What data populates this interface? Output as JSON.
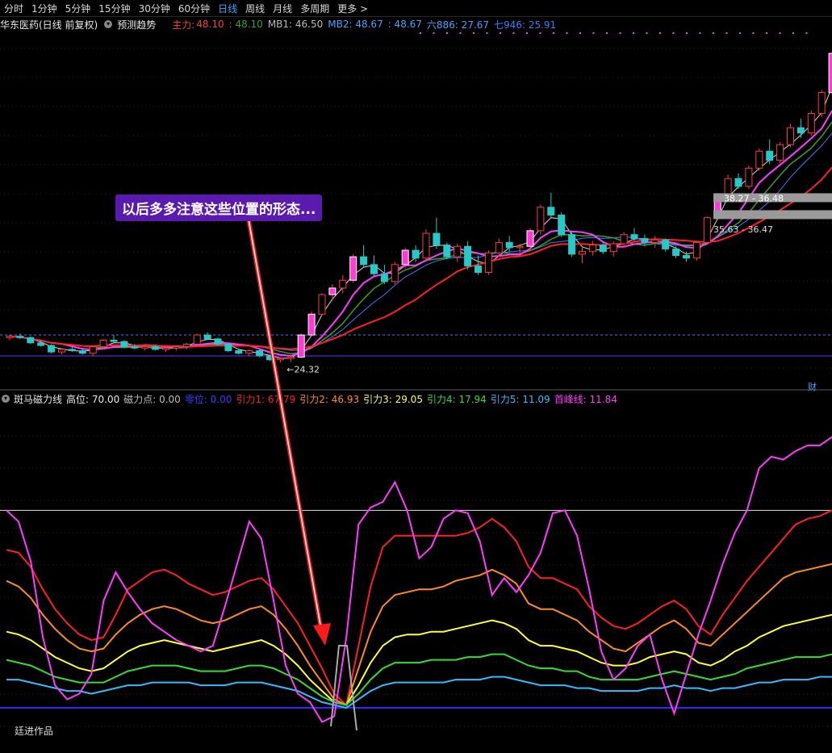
{
  "toolbar": {
    "timeframes": [
      "分时",
      "1分钟",
      "5分钟",
      "15分钟",
      "30分钟",
      "60分钟",
      "日线",
      "周线",
      "月线",
      "多周期",
      "更多 >"
    ],
    "active": "日线"
  },
  "header": {
    "stock": "华东医药(日线 前复权)",
    "forecast_btn": "预测趋势",
    "zhuli_label": "主力:",
    "zhuli_value": "48.10",
    "v2": ": 48.10",
    "mb1": "MB1: 46.50",
    "mb2": "MB2: 48.67",
    "v3": ": 48.67",
    "liu": "六886: 27.67",
    "qi": "七946: 25.91"
  },
  "callout": "以后多多注意这些位置的形态...",
  "indicator_header": {
    "name": "斑马磁力线",
    "gaowei": "高位: 70.00",
    "cilidian": "磁力点: 0.00",
    "lingwei": "零位: 0.00",
    "y1": "引力1: 67.79",
    "y2": "引力2: 46.93",
    "y3": "引力3: 29.05",
    "y4": "引力4: 17.94",
    "y5": "引力5: 11.09",
    "sf": "首峰线: 11.84"
  },
  "author": "廷进作品",
  "cai": "财",
  "colors": {
    "up": "#ff3b3b",
    "down": "#27c8c8",
    "signal_fill": "#ff3bd2",
    "ma_white": "#d8d8d8",
    "ma_mag": "#ff3bff",
    "ma_red": "#ff2020",
    "ma_green": "#2ea52e",
    "ma_blue": "#3b7bff",
    "y1": "#ff2020",
    "y2": "#ff8c1a",
    "y3": "#ffff33",
    "y4": "#33dd33",
    "y5": "#33bbff",
    "sf": "#ff3bff",
    "zhuli": "#ff3b3b",
    "mb2": "#3ea6ff",
    "liu": "#3ea6ff",
    "qi": "#3b7bff"
  },
  "chart_data": [
    {
      "type": "candlestick",
      "title": "华东医药(日线 前复权)",
      "candles": [
        [
          26.2,
          26.4,
          26.0,
          26.3
        ],
        [
          26.3,
          26.5,
          26.1,
          26.2
        ],
        [
          26.2,
          26.3,
          25.7,
          25.8
        ],
        [
          25.8,
          26.0,
          25.5,
          25.6
        ],
        [
          25.6,
          25.7,
          25.0,
          25.1
        ],
        [
          25.1,
          25.4,
          24.9,
          25.3
        ],
        [
          25.3,
          25.5,
          25.1,
          25.2
        ],
        [
          25.2,
          25.4,
          24.9,
          25.0
        ],
        [
          25.0,
          25.6,
          24.8,
          25.5
        ],
        [
          25.5,
          26.1,
          25.3,
          26.0
        ],
        [
          26.0,
          26.4,
          25.8,
          25.9
        ],
        [
          25.9,
          26.0,
          25.4,
          25.5
        ],
        [
          25.5,
          25.7,
          25.3,
          25.4
        ],
        [
          25.4,
          25.6,
          25.2,
          25.5
        ],
        [
          25.5,
          25.6,
          25.2,
          25.3
        ],
        [
          25.3,
          25.5,
          25.1,
          25.4
        ],
        [
          25.4,
          25.6,
          25.2,
          25.5
        ],
        [
          25.5,
          25.8,
          25.3,
          25.7
        ],
        [
          25.7,
          26.5,
          25.6,
          26.4
        ],
        [
          26.4,
          26.6,
          26.0,
          26.1
        ],
        [
          26.1,
          26.2,
          25.6,
          25.7
        ],
        [
          25.7,
          25.8,
          25.1,
          25.2
        ],
        [
          25.2,
          25.3,
          24.9,
          25.0
        ],
        [
          25.0,
          25.3,
          24.8,
          25.2
        ],
        [
          25.2,
          25.3,
          24.7,
          24.8
        ],
        [
          24.8,
          24.9,
          24.4,
          24.5
        ],
        [
          24.5,
          24.7,
          24.3,
          24.6
        ],
        [
          24.6,
          24.8,
          24.32,
          24.7
        ],
        [
          24.7,
          26.5,
          24.6,
          26.4
        ],
        [
          26.4,
          28.2,
          26.3,
          28.0
        ],
        [
          28.0,
          29.6,
          27.9,
          29.5
        ],
        [
          29.5,
          30.3,
          29.0,
          30.0
        ],
        [
          30.0,
          31.0,
          29.6,
          30.6
        ],
        [
          30.6,
          32.6,
          30.4,
          32.4
        ],
        [
          32.4,
          33.3,
          31.6,
          31.8
        ],
        [
          31.8,
          32.5,
          30.9,
          31.1
        ],
        [
          31.1,
          31.8,
          30.3,
          30.5
        ],
        [
          30.5,
          32.0,
          30.3,
          31.8
        ],
        [
          31.8,
          33.1,
          31.5,
          32.9
        ],
        [
          32.9,
          33.3,
          32.0,
          32.3
        ],
        [
          32.3,
          34.5,
          32.0,
          34.2
        ],
        [
          34.2,
          35.4,
          33.0,
          33.3
        ],
        [
          33.3,
          33.5,
          32.2,
          32.4
        ],
        [
          32.4,
          33.4,
          32.0,
          33.2
        ],
        [
          33.2,
          33.6,
          31.4,
          31.7
        ],
        [
          31.7,
          32.5,
          31.0,
          31.2
        ],
        [
          31.2,
          32.9,
          31.0,
          32.7
        ],
        [
          32.7,
          33.8,
          32.4,
          33.5
        ],
        [
          33.5,
          34.0,
          32.8,
          33.1
        ],
        [
          33.1,
          33.4,
          32.6,
          33.2
        ],
        [
          33.2,
          34.6,
          33.0,
          34.4
        ],
        [
          34.4,
          36.4,
          34.1,
          36.2
        ],
        [
          36.2,
          37.3,
          35.4,
          35.6
        ],
        [
          35.6,
          35.8,
          33.9,
          34.1
        ],
        [
          34.1,
          34.4,
          32.4,
          32.6
        ],
        [
          32.6,
          33.1,
          31.9,
          32.8
        ],
        [
          32.8,
          33.6,
          32.5,
          33.3
        ],
        [
          33.3,
          33.6,
          32.6,
          32.8
        ],
        [
          32.8,
          33.6,
          32.4,
          33.4
        ],
        [
          33.4,
          34.3,
          33.1,
          34.1
        ],
        [
          34.1,
          34.6,
          33.6,
          33.8
        ],
        [
          33.8,
          34.1,
          33.2,
          33.5
        ],
        [
          33.5,
          34.0,
          33.1,
          33.7
        ],
        [
          33.7,
          33.8,
          32.8,
          33.0
        ],
        [
          33.0,
          33.2,
          32.3,
          32.5
        ],
        [
          32.5,
          32.8,
          32.0,
          32.3
        ],
        [
          32.3,
          33.6,
          32.1,
          33.5
        ],
        [
          33.5,
          35.5,
          33.4,
          35.4
        ],
        [
          35.4,
          37.3,
          35.2,
          37.1
        ],
        [
          37.1,
          38.7,
          36.8,
          38.4
        ],
        [
          38.4,
          38.8,
          37.6,
          37.8
        ],
        [
          37.8,
          39.4,
          37.6,
          39.2
        ],
        [
          39.2,
          40.7,
          39.0,
          40.5
        ],
        [
          40.5,
          41.4,
          39.5,
          39.8
        ],
        [
          39.8,
          41.2,
          39.6,
          41.0
        ],
        [
          41.0,
          42.6,
          40.8,
          42.3
        ],
        [
          42.3,
          43.0,
          41.5,
          41.9
        ],
        [
          41.9,
          43.6,
          41.7,
          43.4
        ],
        [
          43.4,
          45.2,
          43.1,
          45.0
        ],
        [
          45.0,
          48.1,
          44.8,
          48.0
        ]
      ],
      "annotations": [
        "←24.32",
        "38.27 - 36.48",
        "35.63 - 36.47"
      ]
    },
    {
      "type": "line",
      "title": "斑马磁力线",
      "reference_levels": {
        "高位": 70.0,
        "零位": 0.0
      },
      "series": [
        {
          "name": "引力1",
          "color": "#ff2020",
          "values": [
            56,
            55,
            50,
            42,
            35,
            30,
            26,
            24,
            25,
            33,
            42,
            45,
            48,
            49,
            47,
            44,
            42,
            40,
            41,
            43,
            45,
            46,
            42,
            36,
            30,
            22,
            14,
            5,
            1,
            22,
            43,
            57,
            61,
            61,
            61,
            61,
            61,
            61,
            62,
            64,
            67,
            64,
            59,
            50,
            46,
            46,
            44,
            42,
            36,
            32,
            29,
            28,
            30,
            33,
            36,
            38,
            35,
            29,
            26,
            33,
            39,
            45,
            50,
            55,
            60,
            65,
            67,
            68,
            70
          ]
        },
        {
          "name": "引力2",
          "color": "#ff8c1a",
          "values": [
            45,
            43,
            39,
            33,
            28,
            24,
            21,
            20,
            21,
            26,
            30,
            33,
            35,
            36,
            35,
            33,
            31,
            30,
            31,
            33,
            35,
            36,
            33,
            28,
            22,
            15,
            9,
            3,
            1,
            14,
            27,
            36,
            40,
            41,
            42,
            42,
            43,
            45,
            46,
            47,
            49,
            47,
            44,
            37,
            35,
            35,
            33,
            31,
            27,
            24,
            21,
            20,
            23,
            26,
            29,
            31,
            28,
            23,
            22,
            26,
            30,
            34,
            38,
            42,
            46,
            48,
            49,
            50,
            51
          ]
        },
        {
          "name": "引力3",
          "color": "#ffff33",
          "values": [
            27,
            26,
            24,
            21,
            18,
            16,
            14,
            13,
            14,
            17,
            20,
            22,
            23,
            24,
            23,
            22,
            21,
            20,
            21,
            22,
            23,
            24,
            22,
            19,
            15,
            10,
            6,
            2,
            1,
            8,
            16,
            22,
            25,
            26,
            26,
            27,
            27,
            28,
            29,
            30,
            31,
            30,
            28,
            24,
            22,
            22,
            21,
            20,
            18,
            16,
            15,
            15,
            16,
            18,
            19,
            20,
            19,
            16,
            15,
            17,
            20,
            22,
            25,
            27,
            29,
            30,
            31,
            32,
            33
          ]
        },
        {
          "name": "引力4",
          "color": "#33dd33",
          "values": [
            17,
            16,
            15,
            13,
            11,
            10,
            9,
            9,
            9,
            11,
            13,
            14,
            15,
            15,
            15,
            14,
            13,
            13,
            13,
            14,
            15,
            15,
            14,
            12,
            10,
            7,
            4,
            2,
            1,
            5,
            10,
            14,
            16,
            16,
            16,
            17,
            17,
            17,
            18,
            18,
            19,
            19,
            17,
            15,
            14,
            14,
            13,
            13,
            11,
            10,
            10,
            10,
            10,
            11,
            12,
            13,
            12,
            11,
            10,
            11,
            12,
            14,
            15,
            16,
            17,
            18,
            18,
            18,
            19
          ]
        },
        {
          "name": "引力5",
          "color": "#33bbff",
          "values": [
            10,
            10,
            9,
            8,
            7,
            6,
            6,
            5,
            6,
            7,
            8,
            8,
            9,
            9,
            9,
            9,
            8,
            8,
            8,
            9,
            9,
            9,
            8,
            7,
            6,
            4,
            2,
            1,
            0,
            3,
            6,
            8,
            9,
            9,
            9,
            9,
            9,
            10,
            10,
            10,
            11,
            11,
            10,
            9,
            8,
            8,
            8,
            7,
            7,
            6,
            6,
            6,
            6,
            7,
            7,
            8,
            7,
            7,
            6,
            7,
            7,
            8,
            9,
            9,
            10,
            10,
            10,
            11,
            11
          ]
        },
        {
          "name": "首峰线",
          "color": "#ff3bff",
          "values": [
            70,
            66,
            52,
            25,
            8,
            3,
            5,
            12,
            38,
            48,
            41,
            35,
            30,
            27,
            24,
            22,
            20,
            22,
            36,
            51,
            66,
            60,
            38,
            15,
            5,
            2,
            -5,
            -3,
            25,
            65,
            71,
            73,
            80,
            70,
            53,
            57,
            67,
            70,
            69,
            59,
            40,
            46,
            41,
            47,
            55,
            69,
            70,
            61,
            42,
            20,
            10,
            14,
            22,
            26,
            10,
            -2,
            12,
            26,
            38,
            51,
            62,
            70,
            85,
            89,
            88,
            91,
            93,
            93,
            96
          ]
        }
      ]
    }
  ]
}
